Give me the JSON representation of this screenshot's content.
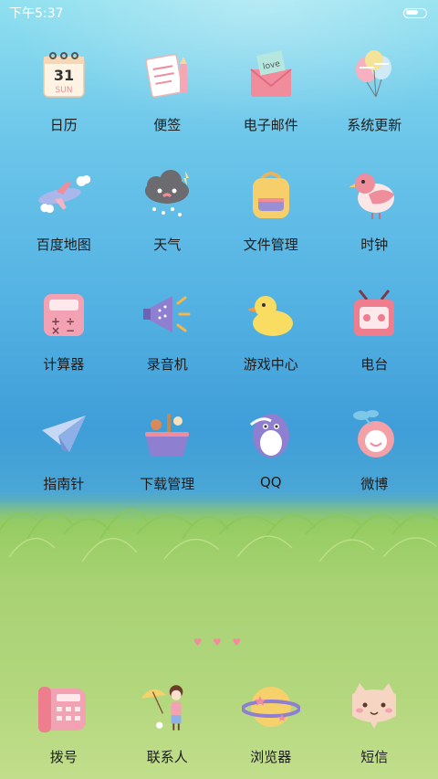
{
  "status_bar": {
    "time": "下午5:37",
    "battery_level": 0.7
  },
  "apps": [
    {
      "label": "日历",
      "icon": "calendar-icon"
    },
    {
      "label": "便签",
      "icon": "notepad-icon"
    },
    {
      "label": "电子邮件",
      "icon": "love-letter-icon"
    },
    {
      "label": "系统更新",
      "icon": "balloons-icon"
    },
    {
      "label": "百度地图",
      "icon": "airplane-icon"
    },
    {
      "label": "天气",
      "icon": "storm-cloud-icon"
    },
    {
      "label": "文件管理",
      "icon": "backpack-icon"
    },
    {
      "label": "时钟",
      "icon": "bird-icon"
    },
    {
      "label": "计算器",
      "icon": "calculator-icon"
    },
    {
      "label": "录音机",
      "icon": "megaphone-icon"
    },
    {
      "label": "游戏中心",
      "icon": "duck-icon"
    },
    {
      "label": "电台",
      "icon": "tv-radio-icon"
    },
    {
      "label": "指南针",
      "icon": "paper-plane-icon"
    },
    {
      "label": "下载管理",
      "icon": "basket-icon"
    },
    {
      "label": "QQ",
      "icon": "penguin-icon"
    },
    {
      "label": "微博",
      "icon": "flower-face-icon"
    }
  ],
  "dock": [
    {
      "label": "拨号",
      "icon": "telephone-icon"
    },
    {
      "label": "联系人",
      "icon": "girl-umbrella-icon"
    },
    {
      "label": "浏览器",
      "icon": "planet-icon"
    },
    {
      "label": "短信",
      "icon": "cat-face-icon"
    }
  ],
  "page_indicator": "♥ ♥ ♥",
  "colors": {
    "accent_pink": "#f08c9c",
    "label_text": "#1c1c1c"
  }
}
